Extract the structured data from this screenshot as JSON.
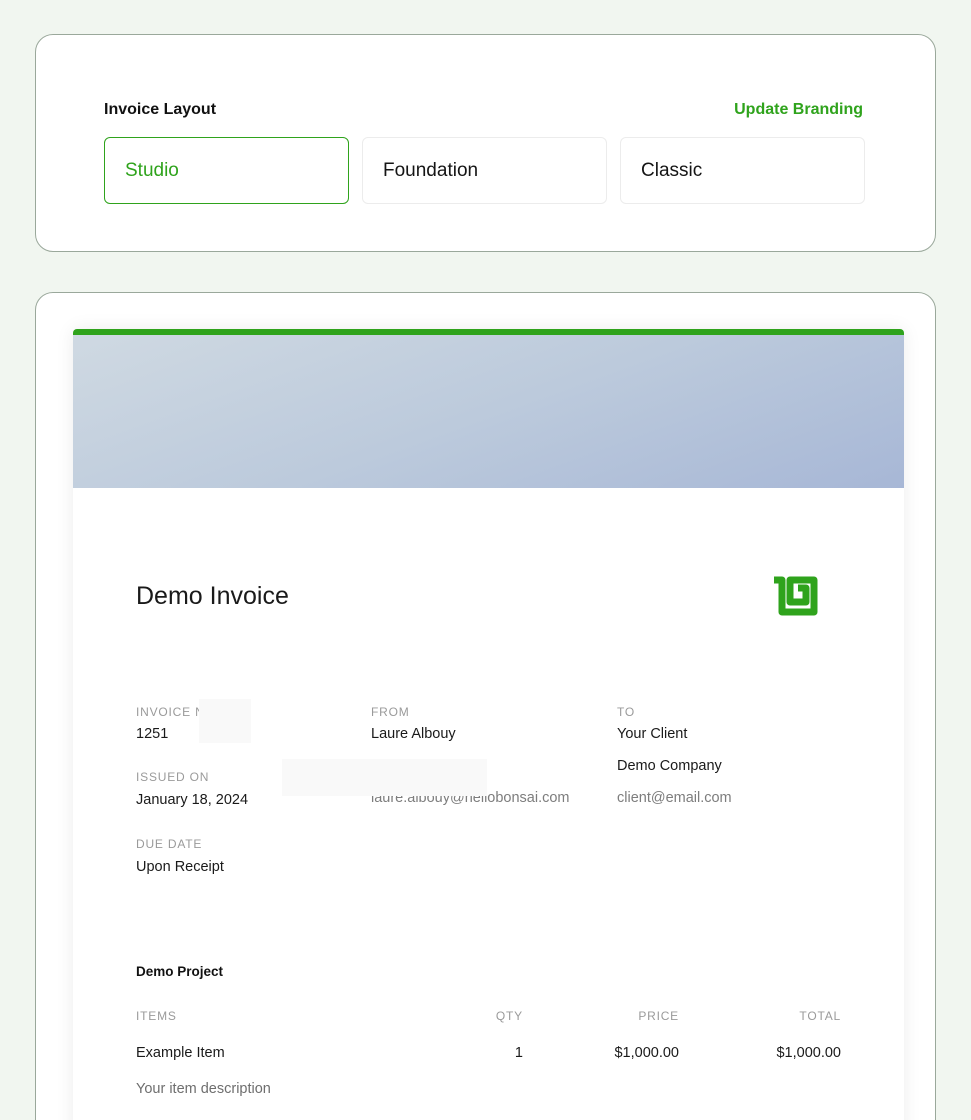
{
  "layout_picker": {
    "heading": "Invoice Layout",
    "branding_link": "Update Branding",
    "options": [
      {
        "label": "Studio",
        "selected": true
      },
      {
        "label": "Foundation",
        "selected": false
      },
      {
        "label": "Classic",
        "selected": false
      }
    ]
  },
  "invoice": {
    "title": "Demo Invoice",
    "logo_icon": "bonsai-logo-icon",
    "invoice_number_label": "INVOICE N",
    "invoice_number": "1251",
    "issued_on_label": "ISSUED ON",
    "issued_on": "January 18, 2024",
    "due_date_label": "DUE DATE",
    "due_date": "Upon Receipt",
    "from_label": "FROM",
    "from_name": "Laure Albouy",
    "from_email": "laure.albouy@hellobonsai.com",
    "to_label": "TO",
    "to_name": "Your Client",
    "to_company": "Demo Company",
    "to_email": "client@email.com",
    "project": "Demo Project",
    "table": {
      "headers": {
        "items": "ITEMS",
        "qty": "QTY",
        "price": "PRICE",
        "total": "TOTAL"
      },
      "rows": [
        {
          "item": "Example Item",
          "qty": "1",
          "price": "$1,000.00",
          "total": "$1,000.00",
          "description": "Your item description"
        }
      ]
    }
  },
  "colors": {
    "accent": "#2fa31c",
    "background": "#f1f6f0",
    "card_border": "#9aa89b"
  }
}
